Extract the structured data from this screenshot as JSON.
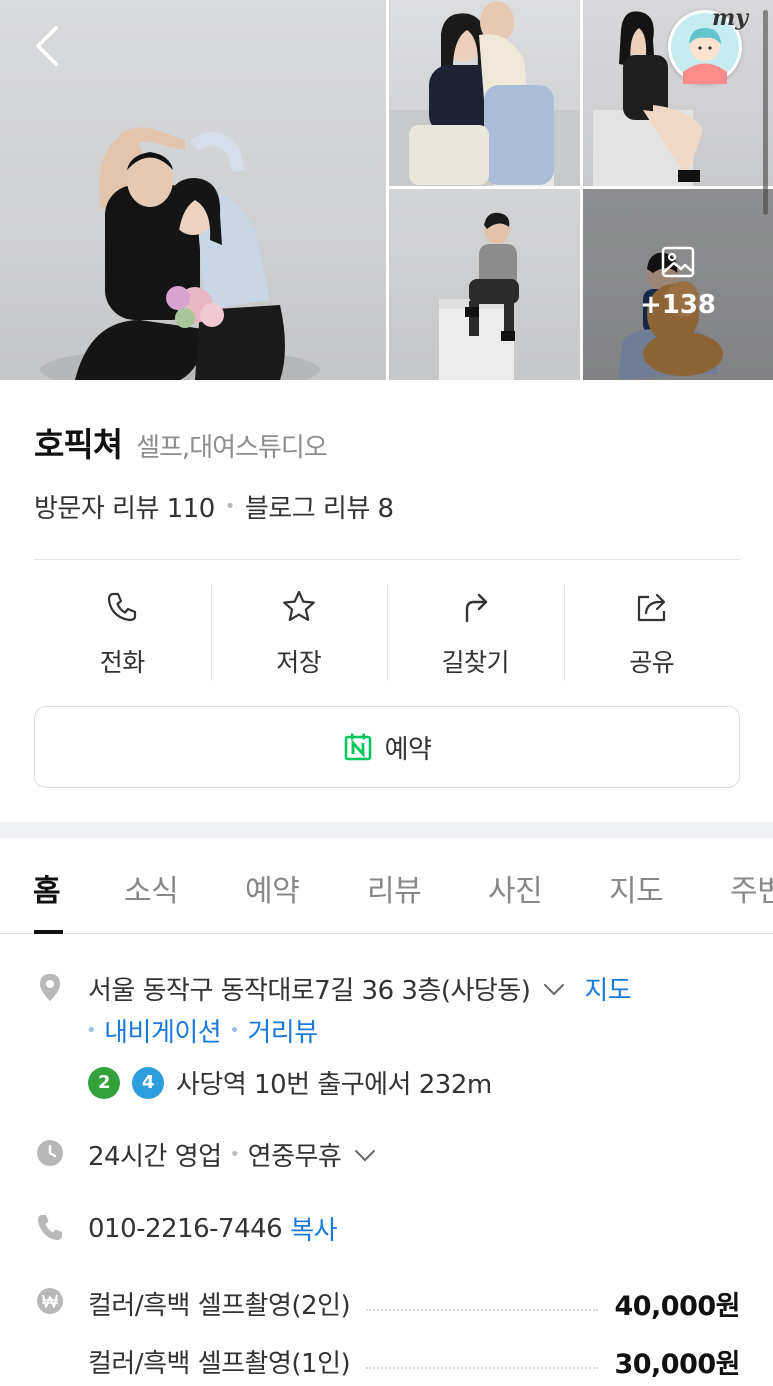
{
  "gallery": {
    "more_count": "+138",
    "my_label": "my"
  },
  "place": {
    "name": "호픽쳐",
    "category": "셀프,대여스튜디오"
  },
  "reviews": {
    "visitor": "방문자 리뷰 110",
    "blog": "블로그 리뷰 8",
    "separator": "•"
  },
  "actions": [
    {
      "label": "전화",
      "icon": "phone-icon"
    },
    {
      "label": "저장",
      "icon": "star-icon"
    },
    {
      "label": "길찾기",
      "icon": "directions-icon"
    },
    {
      "label": "공유",
      "icon": "share-icon"
    }
  ],
  "reserve": {
    "label": "예약",
    "icon": "naver-booking-icon",
    "icon_color": "#03c75a"
  },
  "tabs": [
    "홈",
    "소식",
    "예약",
    "리뷰",
    "사진",
    "지도",
    "주변"
  ],
  "active_tab": "홈",
  "address": {
    "text": "서울 동작구 동작대로7길 36 3층(사당동)",
    "map_link": "지도",
    "navigation_link": "내비게이션",
    "street_view_link": "거리뷰",
    "separator": "•"
  },
  "subway": {
    "lines": [
      {
        "number": "2",
        "color": "#33a23d"
      },
      {
        "number": "4",
        "color": "#2c9ede"
      }
    ],
    "text": "사당역 10번 출구에서 232m"
  },
  "hours": {
    "text": "24시간 영업",
    "separator": "•",
    "holiday": "연중무휴"
  },
  "phone": {
    "number": "010-2216-7446",
    "copy_label": "복사"
  },
  "prices": [
    {
      "item": "컬러/흑백 셀프촬영(2인)",
      "price": "40,000원"
    },
    {
      "item": "컬러/흑백 셀프촬영(1인)",
      "price": "30,000원"
    }
  ],
  "colors": {
    "link": "#1a7ad9",
    "naver_green": "#03c75a",
    "icon_gray": "#b5b5b5"
  }
}
